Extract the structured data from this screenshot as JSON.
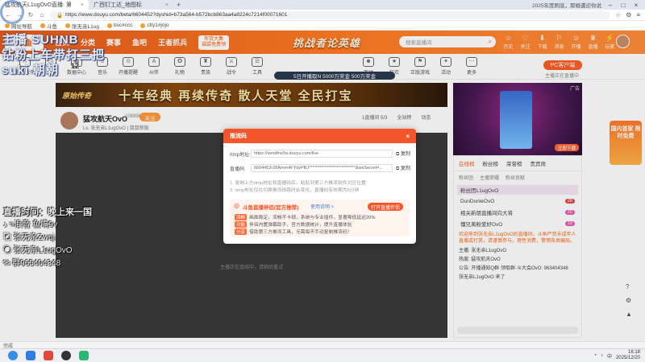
{
  "browser": {
    "tabs": [
      {
        "title": "猛攻航天L1ugOvO直播: 第",
        "active": true
      },
      {
        "title": "广西钉工达_地图标",
        "active": false
      }
    ],
    "url": "https://www.douyu.com/beta/6604452?dyshid=b73a564-b572bcb863aa4a8224c7214f00071601",
    "right_text": "2025年度刷底，那婚遭迎你说",
    "bookmarks": [
      "网址导航",
      "斗鱼",
      "张无亲L1ug",
      "bsc#ccc",
      "clty1#jojo"
    ]
  },
  "site": {
    "logo": "斗鱼",
    "nav": [
      "首页",
      "分类",
      "赛事",
      "鱼吧",
      "王者抓兵"
    ],
    "promo_badge": [
      "年货大集",
      "福袋免费领"
    ],
    "banner_title": "挑战者论英雄",
    "search_placeholder": "搜索直播间",
    "header_icons": [
      {
        "glyph": "☆",
        "label": "历史"
      },
      {
        "glyph": "♡",
        "label": "关注"
      },
      {
        "glyph": "⬇",
        "label": "下载"
      },
      {
        "glyph": "⚐",
        "label": "消息"
      },
      {
        "glyph": "☺",
        "label": "开播"
      },
      {
        "glyph": "♛",
        "label": "直播"
      },
      {
        "glyph": "⚡",
        "label": "玩家"
      }
    ],
    "categories": [
      {
        "glyph": "⌂",
        "label": "直播伙伴"
      },
      {
        "glyph": "◷",
        "label": "月榜"
      },
      {
        "glyph": "▦",
        "label": "数据中心"
      },
      {
        "glyph": "♫",
        "label": "音乐"
      },
      {
        "glyph": "⊙",
        "label": "开播提醒"
      },
      {
        "glyph": "A",
        "label": "AI伴"
      },
      {
        "glyph": "✪",
        "label": "礼物"
      },
      {
        "glyph": "♜",
        "label": "贵族"
      },
      {
        "glyph": "⚔",
        "label": "战令"
      },
      {
        "glyph": "☰",
        "label": "工具"
      },
      {
        "glyph": "☻",
        "label": "互动"
      },
      {
        "glyph": "★",
        "label": "狂欢"
      },
      {
        "glyph": "⚑",
        "label": "正版游戏"
      },
      {
        "glyph": "✦",
        "label": "活动"
      },
      {
        "glyph": "⋯",
        "label": "更多"
      }
    ],
    "level_text": "12",
    "ticker": "5日开播取N 5000万奖金 500万奖金",
    "pc_button": "PC客户端",
    "cat_note": "主播正在直播中"
  },
  "ad_banner": {
    "logo": "原始传奇",
    "text": "十年经典 再续传奇 散人天堂 全民打宝"
  },
  "room": {
    "streamer": "猛攻航天OvO",
    "room_id": "108896",
    "follow": "关注",
    "meta": "Lv. 张无亲L1ugOvO | 鼠鼠新版",
    "stats": [
      "1直播间 5/3",
      "全站榜",
      "动态"
    ],
    "player_note": "主播正在连线中，请稍后重试"
  },
  "side_ad": {
    "tag": "广告",
    "button": "立即下载"
  },
  "promo_right": "国内首家 限时免费",
  "right_panel": {
    "tabs": [
      "在线榜",
      "粉丝榜",
      "荣誉榜",
      "贵宾席"
    ],
    "subtabs": [
      "粉丝团",
      "主播荣耀",
      "粉丝贡献"
    ],
    "ranks": [
      {
        "name": "粉丝团L1ugOvO",
        "level": "",
        "pink": true
      },
      {
        "name": "DunDunieOvO",
        "level": "28",
        "pink": false
      },
      {
        "name": "相关新朋直播间向大将",
        "level": "20",
        "pink": false
      },
      {
        "name": "懂兄离粉爱好OvO",
        "level": "18",
        "pink": false
      }
    ],
    "notice": "欢迎来到张无亲L1ugOvO的直播间，斗鱼严禁未成年人直播或打赏，请谨慎参与，理性消费，警惕各类骗局。",
    "info": [
      "主播: 张无亲L1ugOvO",
      "热度: 猛攻航天OvO",
      "公告: 开播通知Q群·领取群·斗大会OvO: 963404348"
    ],
    "chat_user": "张无亲L1ugOvO 来了"
  },
  "modal": {
    "title": "推流码",
    "rtmp_label": "rtmp地址:",
    "rtmp_value": "https://sendfrw3a.douyu.com/live",
    "code_label": "直播码:",
    "code_value": "6604452r28Amm4FYdyPBJ***************************&wsSecret=...",
    "copy": "复制",
    "tips": [
      "1. 复制上方rtmp地址和直播码后，粘贴到第三方推流软件对应位置",
      "2. rtmp地址仅在切换推流线路时会变化，直播码有效期为5分钟"
    ],
    "promo_title": "斗鱼直播伴侣(官方推荐)",
    "promo_link": "使用说明 >",
    "promo_button": "打开直播伴侣",
    "points": [
      {
        "tag": "流畅",
        "text": "画面稳定，流畅不卡顿，系统与专业插件，显著降低延迟20%"
      },
      {
        "tag": "功能",
        "text": "伴侣内置弹幕助手，官方数据统计，提升直播体验"
      },
      {
        "tag": "分享",
        "text": "借助第三方推流工具，无需每天手动复制推流码！"
      }
    ]
  },
  "watermark": {
    "top_lines": [
      "主播 SUHNB",
      "钻粉上车带打三把",
      "suki 朝朝"
    ],
    "schedule_title": "直播时间：晚上来一国",
    "contacts": [
      "=浪音 鱼嘴9v",
      "张无亲Zwqi",
      "张无亲L1ugOvO",
      "群965404348"
    ]
  },
  "footer": {
    "status": "完成"
  },
  "taskbar": {
    "time": "16:18",
    "date": "2025/12/20",
    "lang": "中"
  },
  "colors": {
    "brand": "#ff6a1a",
    "modal_header": "#f4552a",
    "player_bg": "#3b3b3b"
  }
}
